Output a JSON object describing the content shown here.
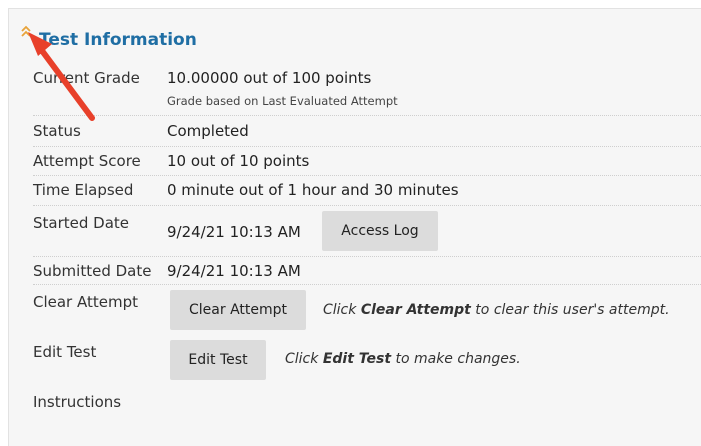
{
  "section": {
    "title": "Test Information"
  },
  "rows": {
    "current_grade": {
      "label": "Current Grade",
      "value": "10.00000 out of 100 points",
      "note": "Grade based on Last Evaluated Attempt"
    },
    "status": {
      "label": "Status",
      "value": "Completed"
    },
    "attempt_score": {
      "label": "Attempt Score",
      "value": "10 out of 10 points"
    },
    "time_elapsed": {
      "label": "Time Elapsed",
      "value": "0 minute out of 1 hour and 30 minutes"
    },
    "started_date": {
      "label": "Started Date",
      "value": "9/24/21 10:13 AM",
      "button": "Access Log"
    },
    "submitted_date": {
      "label": "Submitted Date",
      "value": "9/24/21 10:13 AM"
    },
    "clear_attempt": {
      "label": "Clear Attempt",
      "button": "Clear Attempt",
      "hint_pre": "Click ",
      "hint_bold": "Clear Attempt",
      "hint_post": " to clear this user's attempt."
    },
    "edit_test": {
      "label": "Edit Test",
      "button": "Edit Test",
      "hint_pre": "Click ",
      "hint_bold": "Edit Test",
      "hint_post": " to make changes."
    },
    "instructions": {
      "label": "Instructions"
    }
  },
  "colors": {
    "title": "#1f6ea4",
    "arrow": "#e8402a",
    "collapse_icon": "#e8a33a",
    "button_bg": "#dcdcdc"
  },
  "icons": {
    "collapse": "double-chevron-up-icon",
    "annotation": "red-arrow-icon"
  }
}
